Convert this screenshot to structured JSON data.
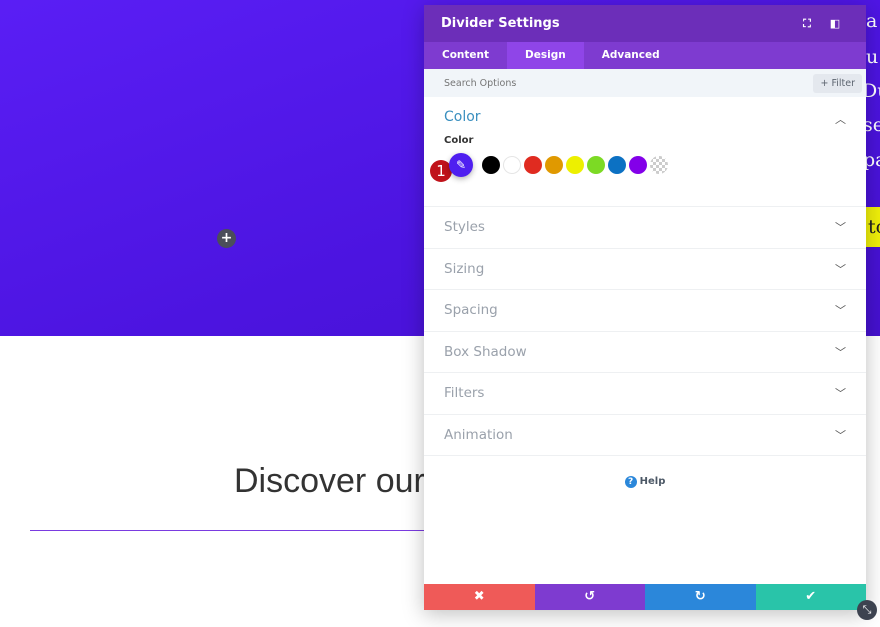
{
  "background": {
    "fragments": [
      "a",
      "u",
      "Du",
      "se",
      "pa"
    ],
    "button_fragment": "to",
    "heading": "Discover our",
    "accent": "#7a3be0"
  },
  "panel": {
    "title": "Divider Settings",
    "tabs": [
      {
        "label": "Content"
      },
      {
        "label": "Design",
        "active": true
      },
      {
        "label": "Advanced"
      }
    ],
    "search_placeholder": "Search Options",
    "filter_label": "+ Filter",
    "color_section": {
      "title": "Color",
      "field_label": "Color",
      "step_badge": "1",
      "selected_color": "#4f1ff0",
      "swatches": [
        "#000000",
        "#ffffff",
        "#e02b20",
        "#e09900",
        "#edf000",
        "#7cda24",
        "#0c71c3",
        "#8300e9",
        "transparent"
      ]
    },
    "sections": [
      "Styles",
      "Sizing",
      "Spacing",
      "Box Shadow",
      "Filters",
      "Animation"
    ],
    "help": "Help",
    "footer": [
      {
        "name": "cancel",
        "icon": "✖",
        "color": "#ef5a58"
      },
      {
        "name": "undo",
        "icon": "↺",
        "color": "#7e3bd0"
      },
      {
        "name": "redo",
        "icon": "↻",
        "color": "#2b87da"
      },
      {
        "name": "save",
        "icon": "✔",
        "color": "#29c4a9"
      }
    ]
  }
}
